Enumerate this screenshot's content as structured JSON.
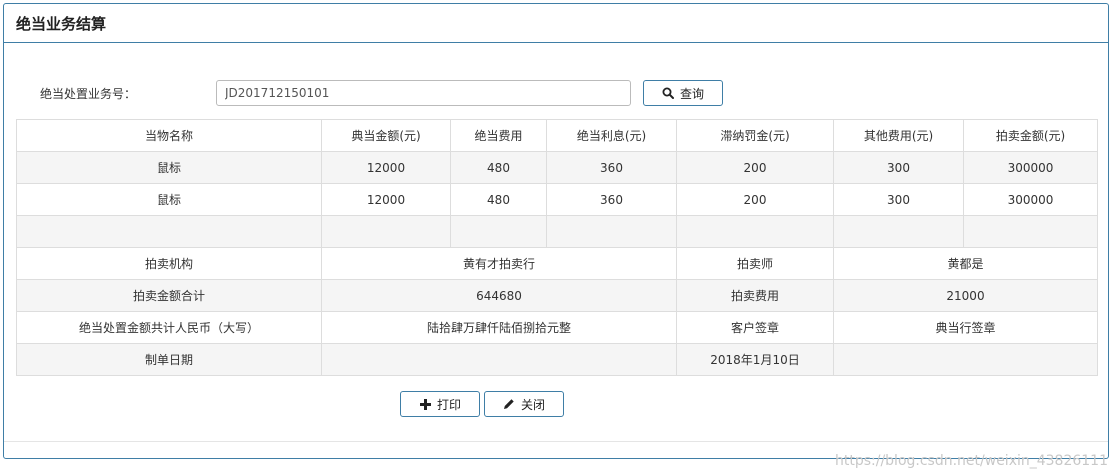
{
  "header": {
    "title": "绝当业务结算"
  },
  "form": {
    "label": "绝当处置业务号：",
    "business_no": "JD201712150101",
    "search_label": "查询"
  },
  "table": {
    "columns": [
      "当物名称",
      "典当金额(元)",
      "绝当费用",
      "绝当利息(元)",
      "滞纳罚金(元)",
      "其他费用(元)",
      "拍卖金额(元)"
    ],
    "rows": [
      [
        "鼠标",
        "12000",
        "480",
        "360",
        "200",
        "300",
        "300000"
      ],
      [
        "鼠标",
        "12000",
        "480",
        "360",
        "200",
        "300",
        "300000"
      ],
      [
        "",
        "",
        "",
        "",
        "",
        "",
        ""
      ]
    ],
    "summary": {
      "auction_org_label": "拍卖机构",
      "auction_org_value": "黄有才拍卖行",
      "auctioneer_label": "拍卖师",
      "auctioneer_value": "黄都是",
      "total_label": "拍卖金额合计",
      "total_value": "644680",
      "fee_label": "拍卖费用",
      "fee_value": "21000",
      "rmb_label": "绝当处置金额共计人民币（大写）",
      "rmb_value": "陆拾肆万肆仟陆佰捌拾元整",
      "customer_sign_label": "客户签章",
      "pawnshop_sign_label": "典当行签章",
      "date_label": "制单日期",
      "date_value": "2018年1月10日"
    }
  },
  "actions": {
    "print_label": "打印",
    "close_label": "关闭"
  },
  "watermark": "https://blog.csdn.net/weixin_43826111",
  "icons": {
    "search": "search-icon",
    "print": "plus-icon",
    "close": "pencil-icon"
  }
}
